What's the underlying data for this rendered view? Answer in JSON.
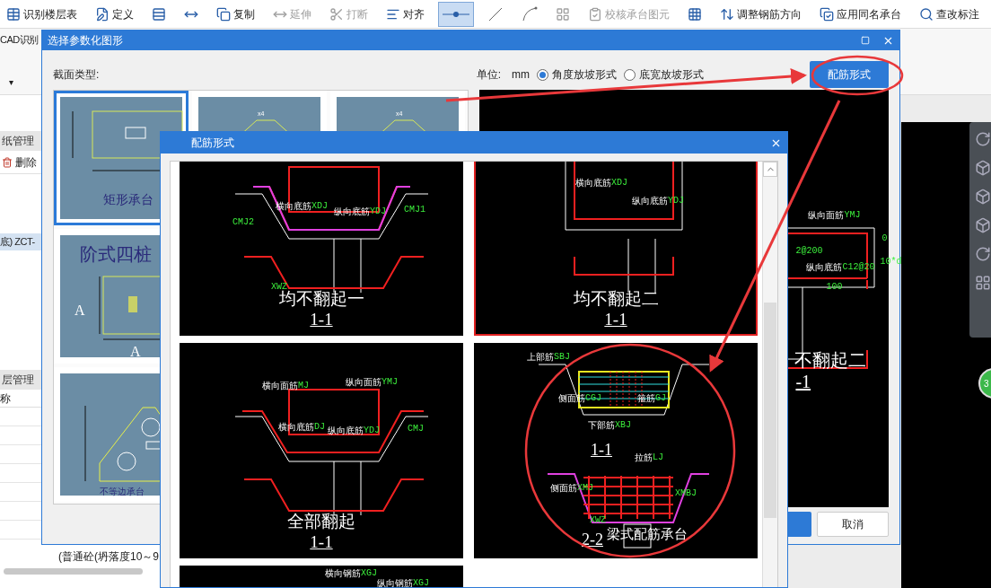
{
  "toolbar": {
    "items": [
      {
        "kind": "text",
        "label": "识别楼层表",
        "disabled": false,
        "selected": false
      },
      {
        "kind": "text",
        "label": "定义",
        "disabled": false,
        "selected": false
      },
      {
        "kind": "icon",
        "disabled": false,
        "selected": false
      },
      {
        "kind": "icon",
        "disabled": false,
        "selected": false
      },
      {
        "kind": "text",
        "label": "复制",
        "disabled": false,
        "selected": false
      },
      {
        "kind": "text",
        "label": "延伸",
        "disabled": true,
        "selected": false
      },
      {
        "kind": "text",
        "label": "打断",
        "disabled": true,
        "selected": false
      },
      {
        "kind": "text",
        "label": "对齐",
        "disabled": false,
        "selected": false
      },
      {
        "kind": "icon",
        "disabled": false,
        "selected": true
      },
      {
        "kind": "icon",
        "disabled": false,
        "selected": false
      },
      {
        "kind": "icon",
        "disabled": false,
        "selected": false
      },
      {
        "kind": "icon",
        "disabled": true,
        "selected": false
      },
      {
        "kind": "text",
        "label": "校核承台图元",
        "disabled": true,
        "selected": false
      },
      {
        "kind": "icon",
        "disabled": false,
        "selected": false
      },
      {
        "kind": "text",
        "label": "调整钢筋方向",
        "disabled": false,
        "selected": false
      },
      {
        "kind": "text",
        "label": "应用同名承台",
        "disabled": false,
        "selected": false
      },
      {
        "kind": "text",
        "label": "查改标注",
        "disabled": false,
        "selected": false
      }
    ]
  },
  "ribbon": {
    "cad_label": "CAD识别",
    "caret": "▾"
  },
  "left_panel": {
    "drawings_header": "纸管理",
    "delete_button": "删除",
    "drawing_rows": [
      {
        "text": "底) ZCT-",
        "selected": true
      }
    ],
    "layers_header": "层管理",
    "layers_column": "称",
    "material_text": "(普通砼(坍落度10～9"
  },
  "dialog": {
    "title": "选择参数化图形",
    "section_type_label": "截面类型:",
    "unit_label": "单位:",
    "unit": "mm",
    "slope_options": [
      {
        "label": "角度放坡形式",
        "selected": true
      },
      {
        "label": "底宽放坡形式",
        "selected": false
      }
    ],
    "rebar_button": "配筋形式",
    "thumbnail_rows": [
      [
        {
          "kind": "rect",
          "caption": "矩形承台",
          "selected": true
        },
        {
          "kind": "trap",
          "caption": "x4",
          "selected": false
        },
        {
          "kind": "trap",
          "caption": "x4",
          "selected": false
        }
      ],
      [
        {
          "kind": "square",
          "caption": "阶式四桩",
          "dims": [
            "A",
            "A"
          ],
          "selected": false
        }
      ],
      [
        {
          "kind": "triangle",
          "caption": "不等边承台",
          "selected": false
        }
      ]
    ],
    "preview": {
      "caption": "不翻起二",
      "section": "-1",
      "labels": [
        {
          "text": "纵向面筋",
          "code": "YMJ"
        },
        {
          "code": "2@200"
        },
        {
          "text": "纵向底筋",
          "code": "C12@20"
        },
        {
          "code": "0"
        },
        {
          "code": "10*d"
        },
        {
          "code": "100"
        }
      ]
    },
    "cancel_button": "取消"
  },
  "rebar_dialog": {
    "title": "配筋形式",
    "cards": [
      {
        "kind": "flat",
        "caption": "均不翻起一",
        "section": "1-1",
        "selected": false,
        "labels": [
          {
            "text": "横向底筋",
            "code": "XDJ"
          },
          {
            "text": "纵向底筋",
            "code": "YDJ"
          },
          {
            "code": "CMJ2"
          },
          {
            "code": "CMJ1"
          },
          {
            "code": "XWZ"
          }
        ]
      },
      {
        "kind": "box",
        "caption": "均不翻起二",
        "section": "1-1",
        "selected": true,
        "labels": [
          {
            "text": "横向底筋",
            "code": "XDJ"
          },
          {
            "text": "纵向底筋",
            "code": "YDJ"
          }
        ]
      },
      {
        "kind": "bent",
        "caption": "全部翻起",
        "section": "1-1",
        "selected": false,
        "labels": [
          {
            "text": "横向面筋",
            "code": "MJ"
          },
          {
            "text": "纵向面筋",
            "code": "YMJ"
          },
          {
            "text": "横向底筋",
            "code": "DJ"
          },
          {
            "text": "纵向底筋",
            "code": "YDJ"
          },
          {
            "code": "CMJ"
          }
        ]
      },
      {
        "kind": "beam",
        "caption": "梁式配筋承台",
        "section": "2-2",
        "section_top": "1-1",
        "selected": false,
        "labels": [
          {
            "text": "上部筋",
            "code": "SBJ"
          },
          {
            "text": "侧面筋",
            "code": "CGJ"
          },
          {
            "text": "箍筋",
            "code": "GJ"
          },
          {
            "text": "下部筋",
            "code": "XBJ"
          },
          {
            "text": "拉筋",
            "code": "LJ"
          },
          {
            "text": "侧面筋",
            "code": "XMJ"
          },
          {
            "code": "XMBJ"
          },
          {
            "code": "XWZ"
          }
        ]
      },
      {
        "kind": "grid",
        "selected": false,
        "labels": [
          {
            "text": "横向钢筋",
            "code": "XGJ"
          },
          {
            "text": "纵向钢筋",
            "code": "XGJ"
          }
        ]
      }
    ]
  },
  "canvas": {
    "badge": "3"
  }
}
